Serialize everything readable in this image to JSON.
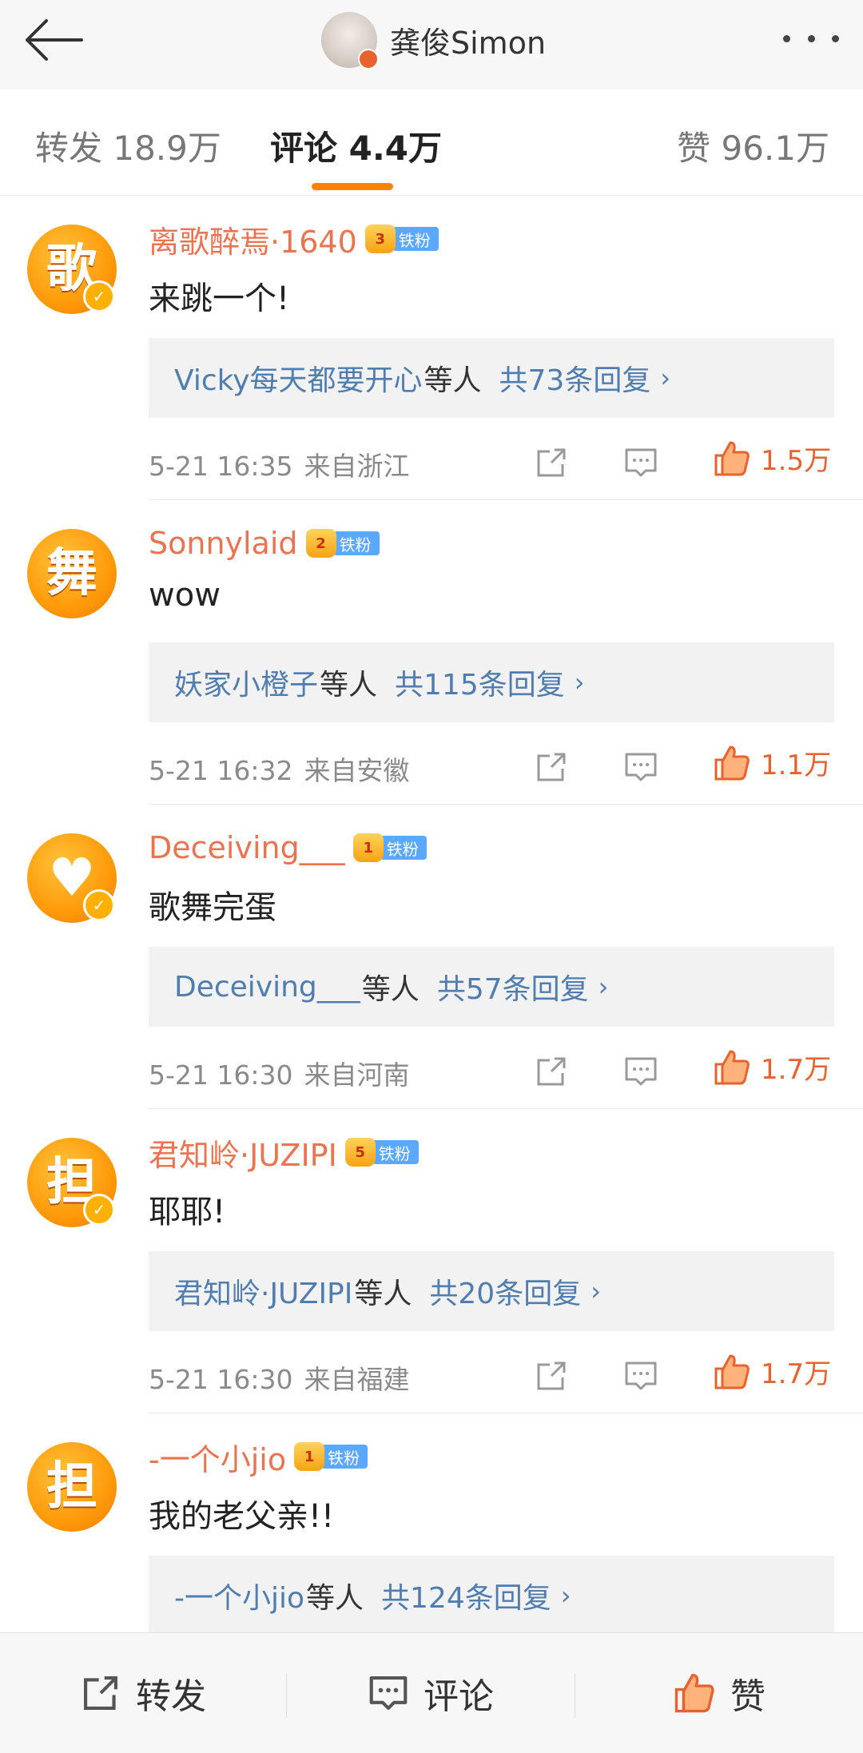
{
  "header": {
    "title": "龚俊Simon"
  },
  "tabs": {
    "repost": "转发 18.9万",
    "comments": "评论 4.4万",
    "likes": "赞 96.1万"
  },
  "colors": {
    "accent": "#ff8200",
    "username": "#eb7350",
    "link": "#507daf",
    "like": "#e8622d",
    "fan_tag": "#5aa8ff"
  },
  "comments": [
    {
      "avatar_char": "歌",
      "name": "离歌醉焉·1640",
      "badge_level": "3",
      "badge": "铁粉",
      "text": "来跳一个!",
      "reply_names": "Vicky每天都要开心",
      "reply_suffix": "等人",
      "reply_count": "共73条回复",
      "time": "5-21 16:35",
      "location": "来自浙江",
      "likes": "1.5万"
    },
    {
      "avatar_char": "舞",
      "name": "Sonnylaid",
      "badge_level": "2",
      "badge": "铁粉",
      "text": "wow",
      "reply_names": "妖家小橙子",
      "reply_suffix": "等人",
      "reply_count": "共115条回复",
      "time": "5-21 16:32",
      "location": "来自安徽",
      "likes": "1.1万"
    },
    {
      "avatar_char": "♥",
      "name": "Deceiving___",
      "badge_level": "1",
      "badge": "铁粉",
      "text": "歌舞完蛋",
      "reply_names": "Deceiving___",
      "reply_suffix": "等人",
      "reply_count": "共57条回复",
      "time": "5-21 16:30",
      "location": "来自河南",
      "likes": "1.7万"
    },
    {
      "avatar_char": "担",
      "name": "君知岭·JUZIPI",
      "badge_level": "5",
      "badge": "铁粉",
      "text": "耶耶!",
      "reply_names": "君知岭·JUZIPI",
      "reply_suffix": "等人",
      "reply_count": "共20条回复",
      "time": "5-21 16:30",
      "location": "来自福建",
      "likes": "1.7万"
    },
    {
      "avatar_char": "担",
      "name": "-一个小jio",
      "badge_level": "1",
      "badge": "铁粉",
      "text": "我的老父亲!!",
      "reply_names": "-一个小jio",
      "reply_suffix": "等人",
      "reply_count": "共124条回复",
      "time": "",
      "location": "",
      "likes": ""
    }
  ],
  "bottombar": {
    "repost": "转发",
    "comment": "评论",
    "like": "赞"
  }
}
